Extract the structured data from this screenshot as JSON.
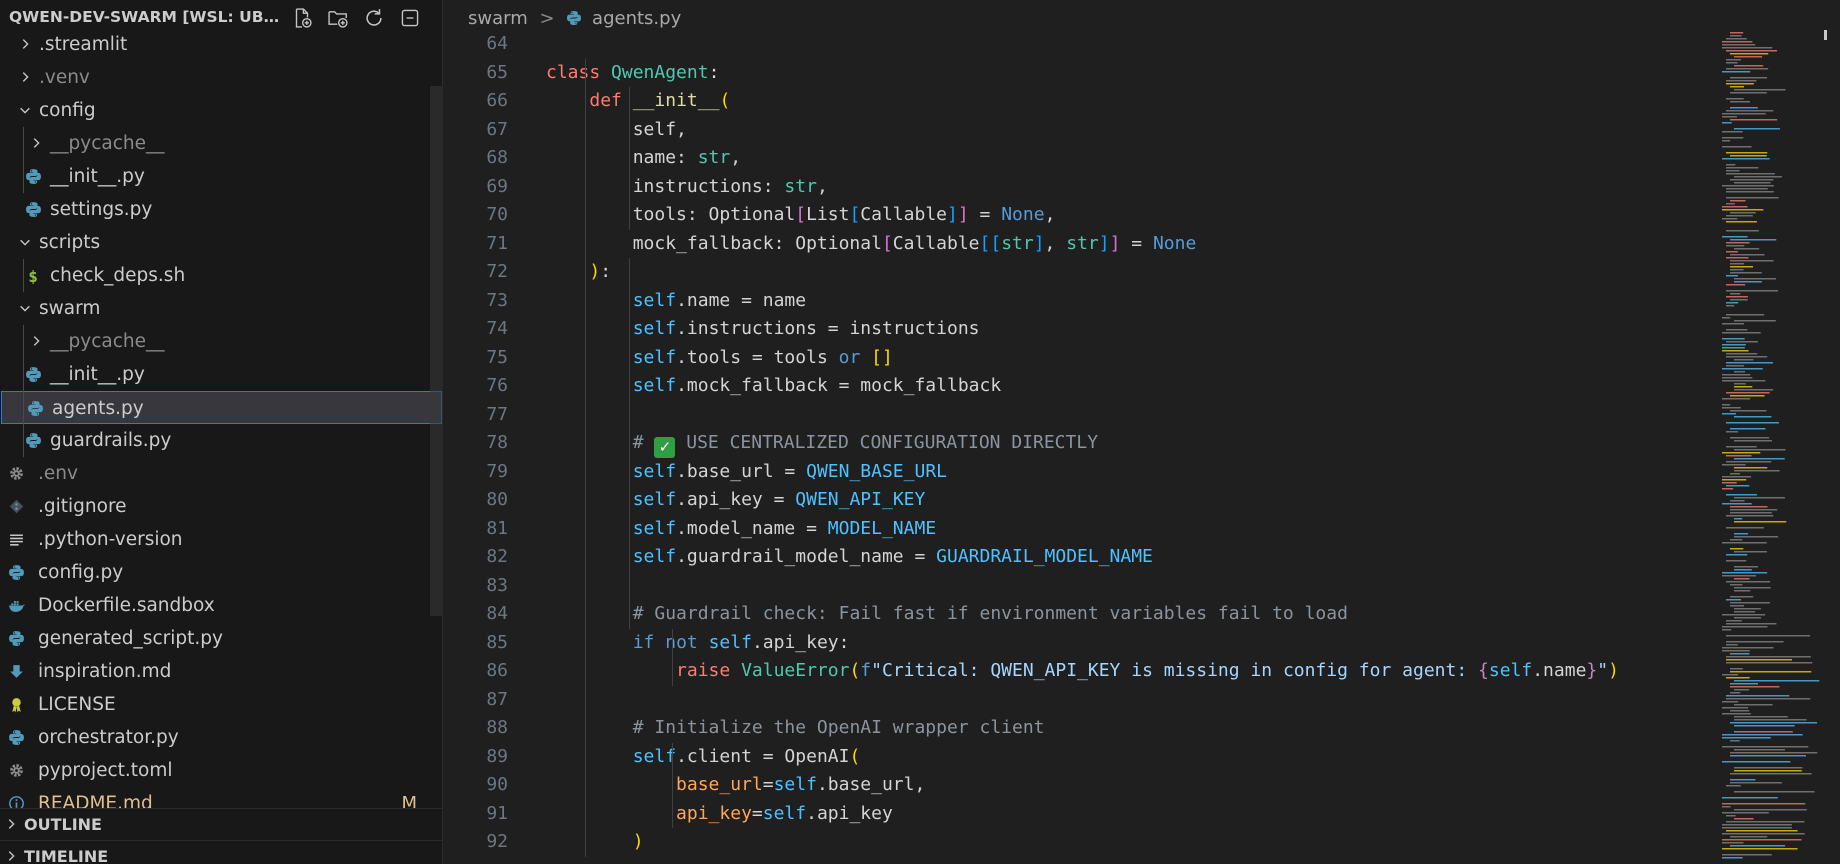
{
  "explorer": {
    "title": "QWEN-DEV-SWARM [WSL: UB...",
    "actions": [
      "new-file-icon",
      "new-folder-icon",
      "refresh-icon",
      "collapse-all-icon"
    ],
    "items": [
      {
        "label": ".streamlit",
        "kind": "folder",
        "expanded": false,
        "depth": 0,
        "icon": "chevron-right-icon"
      },
      {
        "label": ".venv",
        "kind": "folder",
        "expanded": false,
        "depth": 0,
        "icon": "chevron-right-icon",
        "dim": true
      },
      {
        "label": "config",
        "kind": "folder",
        "expanded": true,
        "depth": 0,
        "icon": "chevron-down-icon"
      },
      {
        "label": "__pycache__",
        "kind": "folder",
        "expanded": false,
        "depth": 1,
        "icon": "chevron-right-icon",
        "dim": true
      },
      {
        "label": "__init__.py",
        "kind": "file",
        "depth": 1,
        "icon": "python-icon"
      },
      {
        "label": "settings.py",
        "kind": "file",
        "depth": 1,
        "icon": "python-icon"
      },
      {
        "label": "scripts",
        "kind": "folder",
        "expanded": true,
        "depth": 0,
        "icon": "chevron-down-icon"
      },
      {
        "label": "check_deps.sh",
        "kind": "file",
        "depth": 1,
        "icon": "shell-icon"
      },
      {
        "label": "swarm",
        "kind": "folder",
        "expanded": true,
        "depth": 0,
        "icon": "chevron-down-icon"
      },
      {
        "label": "__pycache__",
        "kind": "folder",
        "expanded": false,
        "depth": 1,
        "icon": "chevron-right-icon",
        "dim": true
      },
      {
        "label": "__init__.py",
        "kind": "file",
        "depth": 1,
        "icon": "python-icon"
      },
      {
        "label": "agents.py",
        "kind": "file",
        "depth": 1,
        "icon": "python-icon",
        "selected": true
      },
      {
        "label": "guardrails.py",
        "kind": "file",
        "depth": 1,
        "icon": "python-icon"
      },
      {
        "label": ".env",
        "kind": "file",
        "depth": 0,
        "icon": "gear-icon",
        "dim": true
      },
      {
        "label": ".gitignore",
        "kind": "file",
        "depth": 0,
        "icon": "git-icon"
      },
      {
        "label": ".python-version",
        "kind": "file",
        "depth": 0,
        "icon": "lines-icon"
      },
      {
        "label": "config.py",
        "kind": "file",
        "depth": 0,
        "icon": "python-icon"
      },
      {
        "label": "Dockerfile.sandbox",
        "kind": "file",
        "depth": 0,
        "icon": "docker-icon"
      },
      {
        "label": "generated_script.py",
        "kind": "file",
        "depth": 0,
        "icon": "python-icon"
      },
      {
        "label": "inspiration.md",
        "kind": "file",
        "depth": 0,
        "icon": "markdown-icon"
      },
      {
        "label": "LICENSE",
        "kind": "file",
        "depth": 0,
        "icon": "license-icon"
      },
      {
        "label": "orchestrator.py",
        "kind": "file",
        "depth": 0,
        "icon": "python-icon"
      },
      {
        "label": "pyproject.toml",
        "kind": "file",
        "depth": 0,
        "icon": "gear-icon"
      },
      {
        "label": "README.md",
        "kind": "file",
        "depth": 0,
        "icon": "info-icon",
        "modified": true,
        "badge": "M"
      }
    ]
  },
  "sections": {
    "outline": "OUTLINE",
    "timeline": "TIMELINE"
  },
  "breadcrumb": {
    "folder": "swarm",
    "separator": ">",
    "file": "agents.py"
  },
  "code": {
    "first_line": 64,
    "lines": [
      {
        "n": "64",
        "tokens": []
      },
      {
        "n": "65",
        "tokens": [
          [
            "kw",
            "class"
          ],
          [
            "",
            "",
            " "
          ],
          [
            "cls",
            "QwenAgent"
          ],
          [
            "",
            ":"
          ]
        ]
      },
      {
        "n": "66",
        "tokens": [
          [
            "",
            "",
            " "
          ],
          [
            "",
            "",
            " "
          ],
          [
            "",
            "",
            " "
          ],
          [
            "",
            "",
            " "
          ],
          [
            "fn",
            "def"
          ],
          [
            "",
            "",
            " "
          ],
          [
            "fncall",
            "__init__"
          ],
          [
            "br1",
            "("
          ]
        ]
      },
      {
        "n": "67",
        "tokens": [
          [
            "",
            "        self,"
          ]
        ]
      },
      {
        "n": "68",
        "tokens": [
          [
            "",
            "        name: "
          ],
          [
            "type",
            "str"
          ],
          [
            "",
            ","
          ]
        ]
      },
      {
        "n": "69",
        "tokens": [
          [
            "",
            "        instructions: "
          ],
          [
            "type",
            "str"
          ],
          [
            "",
            ","
          ]
        ]
      },
      {
        "n": "70",
        "tokens": [
          [
            "",
            "        tools: Optional"
          ],
          [
            "br2",
            "["
          ],
          [
            "",
            "List"
          ],
          [
            "br3",
            "["
          ],
          [
            "",
            "Callable"
          ],
          [
            "br3",
            "]"
          ],
          [
            "br2",
            "]"
          ],
          [
            "",
            "",
            " = "
          ],
          [
            "none",
            "None"
          ],
          [
            "",
            ","
          ]
        ]
      },
      {
        "n": "71",
        "tokens": [
          [
            "",
            "        mock_fallback: Optional"
          ],
          [
            "br2",
            "["
          ],
          [
            "",
            "Callable"
          ],
          [
            "br3",
            "[["
          ],
          [
            "br1",
            ""
          ],
          [
            "type",
            "str"
          ],
          [
            "br3",
            "]"
          ],
          [
            "",
            ", "
          ],
          [
            "type",
            "str"
          ],
          [
            "br3",
            "]"
          ],
          [
            "br2",
            "]"
          ],
          [
            "",
            "",
            " = "
          ],
          [
            "none",
            "None"
          ]
        ]
      },
      {
        "n": "72",
        "tokens": [
          [
            "",
            "    "
          ],
          [
            "br1",
            ")"
          ],
          [
            "",
            ":"
          ]
        ]
      },
      {
        "n": "73",
        "tokens": [
          [
            "",
            "        "
          ],
          [
            "selfc",
            "self"
          ],
          [
            "",
            ".name = name"
          ]
        ]
      },
      {
        "n": "74",
        "tokens": [
          [
            "",
            "        "
          ],
          [
            "selfc",
            "self"
          ],
          [
            "",
            ".instructions = instructions"
          ]
        ]
      },
      {
        "n": "75",
        "tokens": [
          [
            "",
            "        "
          ],
          [
            "selfc",
            "self"
          ],
          [
            "",
            ".tools = tools "
          ],
          [
            "kw2",
            "or"
          ],
          [
            "",
            "",
            " "
          ],
          [
            "br1",
            "[]"
          ]
        ]
      },
      {
        "n": "76",
        "tokens": [
          [
            "",
            "        "
          ],
          [
            "selfc",
            "self"
          ],
          [
            "",
            ".mock_fallback = mock_fallback"
          ]
        ]
      },
      {
        "n": "77",
        "tokens": []
      },
      {
        "n": "78",
        "tokens": [
          [
            "",
            "        "
          ],
          [
            "cmt",
            "# "
          ],
          [
            "check",
            "✓"
          ],
          [
            "cmt",
            " USE CENTRALIZED CONFIGURATION DIRECTLY"
          ]
        ]
      },
      {
        "n": "79",
        "tokens": [
          [
            "",
            "        "
          ],
          [
            "selfc",
            "self"
          ],
          [
            "",
            ".base_url = "
          ],
          [
            "const",
            "QWEN_BASE_URL"
          ]
        ]
      },
      {
        "n": "80",
        "tokens": [
          [
            "",
            "        "
          ],
          [
            "selfc",
            "self"
          ],
          [
            "",
            ".api_key = "
          ],
          [
            "const",
            "QWEN_API_KEY"
          ]
        ]
      },
      {
        "n": "81",
        "tokens": [
          [
            "",
            "        "
          ],
          [
            "selfc",
            "self"
          ],
          [
            "",
            ".model_name = "
          ],
          [
            "const",
            "MODEL_NAME"
          ]
        ]
      },
      {
        "n": "82",
        "tokens": [
          [
            "",
            "        "
          ],
          [
            "selfc",
            "self"
          ],
          [
            "",
            ".guardrail_model_name = "
          ],
          [
            "const",
            "GUARDRAIL_MODEL_NAME"
          ]
        ]
      },
      {
        "n": "83",
        "tokens": []
      },
      {
        "n": "84",
        "tokens": [
          [
            "",
            "        "
          ],
          [
            "cmt",
            "# Guardrail check: Fail fast if environment variables fail to load"
          ]
        ]
      },
      {
        "n": "85",
        "tokens": [
          [
            "",
            "        "
          ],
          [
            "kw2",
            "if"
          ],
          [
            "",
            "",
            " "
          ],
          [
            "kw2",
            "not"
          ],
          [
            "",
            "",
            " "
          ],
          [
            "selfc",
            "self"
          ],
          [
            "",
            ".api_key:"
          ]
        ]
      },
      {
        "n": "86",
        "tokens": [
          [
            "",
            "            "
          ],
          [
            "kw",
            "raise"
          ],
          [
            "",
            "",
            " "
          ],
          [
            "cls",
            "ValueError"
          ],
          [
            "br1",
            "("
          ],
          [
            "fprefix",
            "f"
          ],
          [
            "str",
            "\"Critical: QWEN_API_KEY is missing in config for agent: "
          ],
          [
            "brace",
            "{"
          ],
          [
            "selfc",
            "self"
          ],
          [
            "",
            ".name"
          ],
          [
            "brace",
            "}"
          ],
          [
            "str",
            "\""
          ],
          [
            "br1",
            ")"
          ]
        ]
      },
      {
        "n": "87",
        "tokens": []
      },
      {
        "n": "88",
        "tokens": [
          [
            "",
            "        "
          ],
          [
            "cmt",
            "# Initialize the OpenAI wrapper client"
          ]
        ]
      },
      {
        "n": "89",
        "tokens": [
          [
            "",
            "        "
          ],
          [
            "selfc",
            "self"
          ],
          [
            "",
            ".client = OpenAI"
          ],
          [
            "br1",
            "("
          ]
        ]
      },
      {
        "n": "90",
        "tokens": [
          [
            "",
            "            "
          ],
          [
            "param",
            "base_url"
          ],
          [
            "",
            "="
          ],
          [
            "selfc",
            "self"
          ],
          [
            "",
            ".base_url,"
          ]
        ]
      },
      {
        "n": "91",
        "tokens": [
          [
            "",
            "            "
          ],
          [
            "param",
            "api_key"
          ],
          [
            "",
            "="
          ],
          [
            "selfc",
            "self"
          ],
          [
            "",
            ".api_key"
          ]
        ]
      },
      {
        "n": "92",
        "tokens": [
          [
            "",
            "        "
          ],
          [
            "br1",
            ")"
          ]
        ]
      }
    ]
  },
  "colors": {
    "editor_bg": "#1f1f1f",
    "sidebar_bg": "#181818",
    "selection_border": "#2b79d0",
    "python_icon": "#519aba",
    "modified": "#e2c08d"
  }
}
